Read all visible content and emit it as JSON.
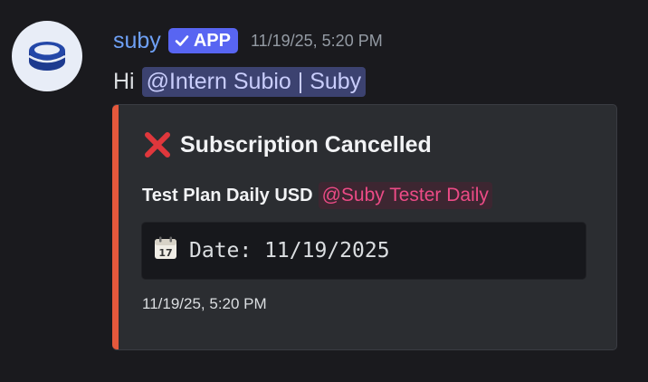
{
  "message": {
    "author": "suby",
    "badge": "APP",
    "timestamp": "11/19/25, 5:20 PM",
    "greeting": "Hi",
    "user_mention": "@Intern Subio | Suby",
    "avatar_icon": "coin-stack-icon"
  },
  "embed": {
    "accent_color": "#e4583c",
    "title_icon": "cross-mark-icon",
    "title": "Subscription Cancelled",
    "plan_name": "Test Plan Daily USD",
    "role_mention": "@Suby Tester Daily",
    "code_icon": "calendar-icon",
    "code_text": "Date: 11/19/2025",
    "footer_timestamp": "11/19/25, 5:20 PM"
  },
  "colors": {
    "background": "#1a1a1e",
    "username": "#6ea0f5",
    "app_badge": "#5865f2",
    "mention_user_bg": "#3c4270",
    "mention_role_text": "#ec4b86"
  }
}
